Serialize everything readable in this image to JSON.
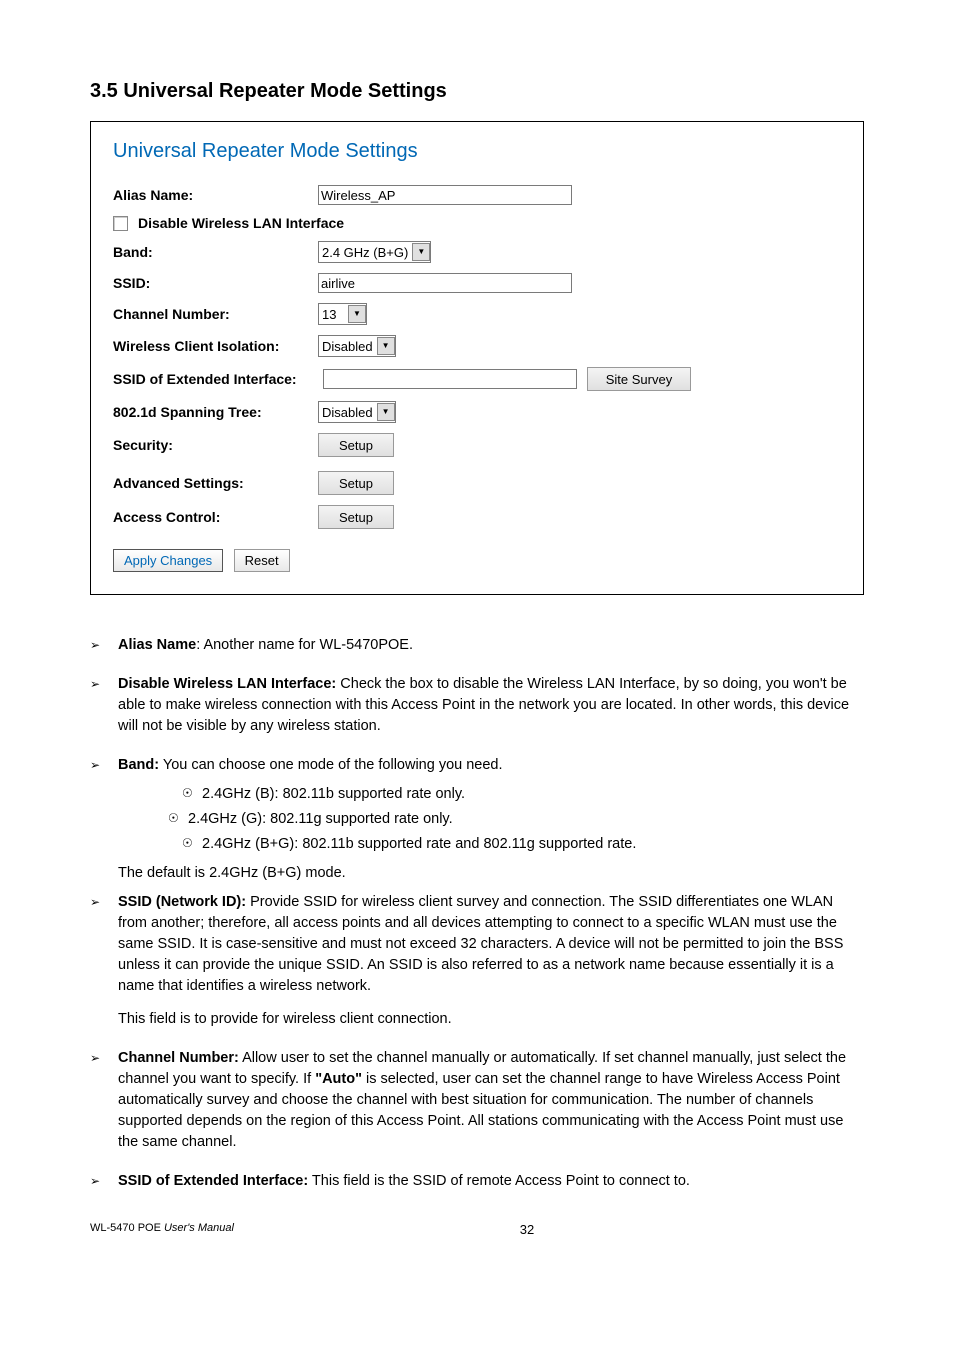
{
  "section_title": "3.5 Universal Repeater Mode Settings",
  "panel": {
    "title": "Universal Repeater Mode Settings",
    "alias_label": "Alias Name:",
    "alias_value": "Wireless_AP",
    "disable_label": "Disable Wireless LAN Interface",
    "band_label": "Band:",
    "band_value": "2.4 GHz (B+G)",
    "ssid_label": "SSID:",
    "ssid_value": "airlive",
    "chan_label": "Channel Number:",
    "chan_value": "13",
    "iso_label": "Wireless Client Isolation:",
    "iso_value": "Disabled",
    "ext_label": "SSID of Extended Interface:",
    "ext_value": "",
    "site_btn": "Site Survey",
    "stp_label": "802.1d Spanning Tree:",
    "stp_value": "Disabled",
    "sec_label": "Security:",
    "adv_label": "Advanced Settings:",
    "ac_label": "Access Control:",
    "setup_btn": "Setup",
    "apply_btn": "Apply Changes",
    "reset_btn": "Reset"
  },
  "desc": {
    "alias_t": "Alias Name",
    "alias_b": ": Another name for WL-5470POE.",
    "dis_t": "Disable Wireless LAN Interface:",
    "dis_b": " Check the box to disable the Wireless LAN Interface, by so doing, you won't be able to make wireless connection with this Access Point in the network you are located. In other words, this device will not be visible by any wireless station.",
    "band_t": "Band:",
    "band_b": " You can choose one mode of the following you need.",
    "band_s1": "2.4GHz (B): 802.11b supported rate only.",
    "band_s2": "2.4GHz (G): 802.11g supported rate only.",
    "band_s3": "2.4GHz (B+G): 802.11b supported rate and 802.11g supported rate.",
    "band_after": "The default is 2.4GHz (B+G) mode.",
    "ssid_t": "SSID (Network ID):",
    "ssid_b": " Provide SSID for wireless client survey and connection. The SSID differentiates one WLAN from another; therefore, all access points and all devices attempting to connect to a specific WLAN must use the same SSID. It is case-sensitive and must not exceed 32 characters. A device will not be permitted to join the BSS unless it can provide the unique SSID. An SSID is also referred to as a network name because essentially it is a name that identifies a wireless network.",
    "ssid_after": "This field is to provide for wireless client connection.",
    "chan_t": "Channel Number:",
    "chan_b1": " Allow user to set the channel manually or automatically. If set channel manually, just select the channel you want to specify. If ",
    "chan_auto": "\"Auto\"",
    "chan_b2": " is selected, user can set the channel range to have Wireless Access Point automatically survey and choose the channel with best situation for communication. The number of channels supported depends on the region of this Access Point. All stations communicating with the Access Point must use the same channel.",
    "ext_t": "SSID of Extended Interface:",
    "ext_b": " This field is the SSID of remote Access Point to connect to."
  },
  "footer": {
    "model": "WL-5470 POE ",
    "manual": "User's Manual",
    "page": "32"
  }
}
